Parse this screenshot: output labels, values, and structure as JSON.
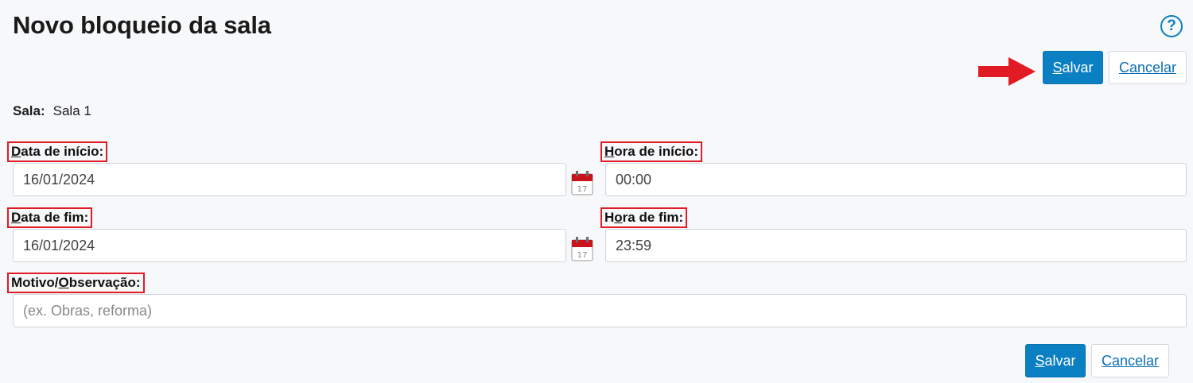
{
  "page": {
    "title": "Novo bloqueio da sala"
  },
  "toolbar": {
    "save_label": "Salvar",
    "save_key": "S",
    "save_rest": "alvar",
    "cancel_label": "Cancelar",
    "cancel_key": "C",
    "cancel_rest": "ancelar"
  },
  "sala": {
    "label": "Sala:",
    "value": "Sala 1"
  },
  "fields": {
    "data_inicio": {
      "key": "D",
      "rest": "ata de início:",
      "value": "16/01/2024"
    },
    "hora_inicio": {
      "key": "H",
      "rest": "ora de início:",
      "value": "00:00"
    },
    "data_fim": {
      "key": "D",
      "rest": "ata de fim:",
      "value": "16/01/2024"
    },
    "hora_fim": {
      "pre": "H",
      "key": "o",
      "rest": "ra de fim:",
      "value": "23:59"
    },
    "motivo": {
      "pre": "Motivo/",
      "key": "O",
      "rest": "bservação:",
      "placeholder": "(ex. Obras, reforma)"
    }
  },
  "icons": {
    "help": "help-circle-icon",
    "calendar": "calendar-icon",
    "arrow": "red-arrow-annotation"
  },
  "colors": {
    "accent": "#0a7fc2",
    "highlight": "#e01b24",
    "calendar_red": "#c9141d"
  }
}
